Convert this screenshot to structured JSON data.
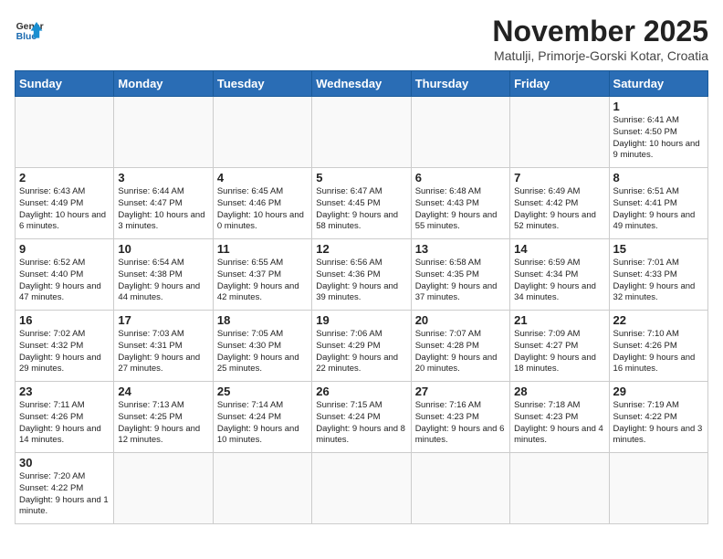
{
  "header": {
    "logo_general": "General",
    "logo_blue": "Blue",
    "month_title": "November 2025",
    "location": "Matulji, Primorje-Gorski Kotar, Croatia"
  },
  "weekdays": [
    "Sunday",
    "Monday",
    "Tuesday",
    "Wednesday",
    "Thursday",
    "Friday",
    "Saturday"
  ],
  "weeks": [
    [
      {
        "day": "",
        "info": ""
      },
      {
        "day": "",
        "info": ""
      },
      {
        "day": "",
        "info": ""
      },
      {
        "day": "",
        "info": ""
      },
      {
        "day": "",
        "info": ""
      },
      {
        "day": "",
        "info": ""
      },
      {
        "day": "1",
        "info": "Sunrise: 6:41 AM\nSunset: 4:50 PM\nDaylight: 10 hours and 9 minutes."
      }
    ],
    [
      {
        "day": "2",
        "info": "Sunrise: 6:43 AM\nSunset: 4:49 PM\nDaylight: 10 hours and 6 minutes."
      },
      {
        "day": "3",
        "info": "Sunrise: 6:44 AM\nSunset: 4:47 PM\nDaylight: 10 hours and 3 minutes."
      },
      {
        "day": "4",
        "info": "Sunrise: 6:45 AM\nSunset: 4:46 PM\nDaylight: 10 hours and 0 minutes."
      },
      {
        "day": "5",
        "info": "Sunrise: 6:47 AM\nSunset: 4:45 PM\nDaylight: 9 hours and 58 minutes."
      },
      {
        "day": "6",
        "info": "Sunrise: 6:48 AM\nSunset: 4:43 PM\nDaylight: 9 hours and 55 minutes."
      },
      {
        "day": "7",
        "info": "Sunrise: 6:49 AM\nSunset: 4:42 PM\nDaylight: 9 hours and 52 minutes."
      },
      {
        "day": "8",
        "info": "Sunrise: 6:51 AM\nSunset: 4:41 PM\nDaylight: 9 hours and 49 minutes."
      }
    ],
    [
      {
        "day": "9",
        "info": "Sunrise: 6:52 AM\nSunset: 4:40 PM\nDaylight: 9 hours and 47 minutes."
      },
      {
        "day": "10",
        "info": "Sunrise: 6:54 AM\nSunset: 4:38 PM\nDaylight: 9 hours and 44 minutes."
      },
      {
        "day": "11",
        "info": "Sunrise: 6:55 AM\nSunset: 4:37 PM\nDaylight: 9 hours and 42 minutes."
      },
      {
        "day": "12",
        "info": "Sunrise: 6:56 AM\nSunset: 4:36 PM\nDaylight: 9 hours and 39 minutes."
      },
      {
        "day": "13",
        "info": "Sunrise: 6:58 AM\nSunset: 4:35 PM\nDaylight: 9 hours and 37 minutes."
      },
      {
        "day": "14",
        "info": "Sunrise: 6:59 AM\nSunset: 4:34 PM\nDaylight: 9 hours and 34 minutes."
      },
      {
        "day": "15",
        "info": "Sunrise: 7:01 AM\nSunset: 4:33 PM\nDaylight: 9 hours and 32 minutes."
      }
    ],
    [
      {
        "day": "16",
        "info": "Sunrise: 7:02 AM\nSunset: 4:32 PM\nDaylight: 9 hours and 29 minutes."
      },
      {
        "day": "17",
        "info": "Sunrise: 7:03 AM\nSunset: 4:31 PM\nDaylight: 9 hours and 27 minutes."
      },
      {
        "day": "18",
        "info": "Sunrise: 7:05 AM\nSunset: 4:30 PM\nDaylight: 9 hours and 25 minutes."
      },
      {
        "day": "19",
        "info": "Sunrise: 7:06 AM\nSunset: 4:29 PM\nDaylight: 9 hours and 22 minutes."
      },
      {
        "day": "20",
        "info": "Sunrise: 7:07 AM\nSunset: 4:28 PM\nDaylight: 9 hours and 20 minutes."
      },
      {
        "day": "21",
        "info": "Sunrise: 7:09 AM\nSunset: 4:27 PM\nDaylight: 9 hours and 18 minutes."
      },
      {
        "day": "22",
        "info": "Sunrise: 7:10 AM\nSunset: 4:26 PM\nDaylight: 9 hours and 16 minutes."
      }
    ],
    [
      {
        "day": "23",
        "info": "Sunrise: 7:11 AM\nSunset: 4:26 PM\nDaylight: 9 hours and 14 minutes."
      },
      {
        "day": "24",
        "info": "Sunrise: 7:13 AM\nSunset: 4:25 PM\nDaylight: 9 hours and 12 minutes."
      },
      {
        "day": "25",
        "info": "Sunrise: 7:14 AM\nSunset: 4:24 PM\nDaylight: 9 hours and 10 minutes."
      },
      {
        "day": "26",
        "info": "Sunrise: 7:15 AM\nSunset: 4:24 PM\nDaylight: 9 hours and 8 minutes."
      },
      {
        "day": "27",
        "info": "Sunrise: 7:16 AM\nSunset: 4:23 PM\nDaylight: 9 hours and 6 minutes."
      },
      {
        "day": "28",
        "info": "Sunrise: 7:18 AM\nSunset: 4:23 PM\nDaylight: 9 hours and 4 minutes."
      },
      {
        "day": "29",
        "info": "Sunrise: 7:19 AM\nSunset: 4:22 PM\nDaylight: 9 hours and 3 minutes."
      }
    ],
    [
      {
        "day": "30",
        "info": "Sunrise: 7:20 AM\nSunset: 4:22 PM\nDaylight: 9 hours and 1 minute."
      },
      {
        "day": "",
        "info": ""
      },
      {
        "day": "",
        "info": ""
      },
      {
        "day": "",
        "info": ""
      },
      {
        "day": "",
        "info": ""
      },
      {
        "day": "",
        "info": ""
      },
      {
        "day": "",
        "info": ""
      }
    ]
  ]
}
